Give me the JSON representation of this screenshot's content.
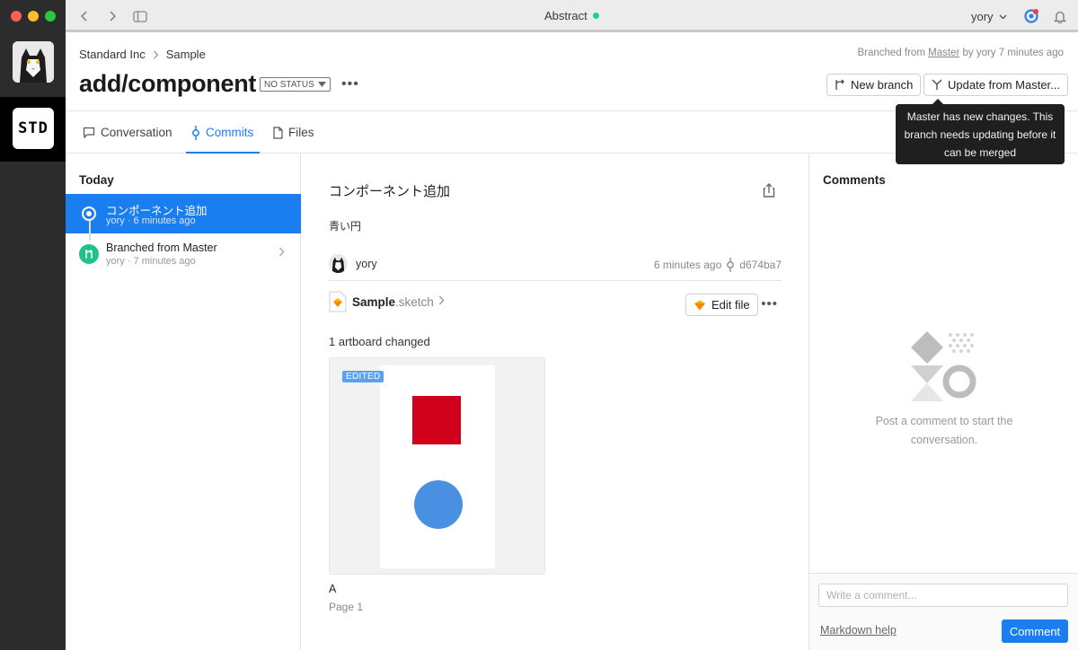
{
  "window": {
    "title": "Abstract",
    "user_name": "yory"
  },
  "org": {
    "logo_text": "STD"
  },
  "header": {
    "breadcrumb": [
      "Standard Inc",
      "Sample"
    ],
    "branched_meta": {
      "prefix": "Branched from",
      "branch_link": "Master",
      "suffix": "by yory 7 minutes ago"
    },
    "branch_title": "add/component",
    "status_label": "NO STATUS",
    "more_label": "•••",
    "new_branch_label": "New branch",
    "update_label": "Update from Master..."
  },
  "tooltip": {
    "text": "Master has new changes. This branch needs updating before it can be merged"
  },
  "tabs": [
    {
      "label": "Conversation",
      "icon": "chat-bubble-icon",
      "active": false
    },
    {
      "label": "Commits",
      "icon": "commit-icon",
      "active": true
    },
    {
      "label": "Files",
      "icon": "file-icon",
      "active": false
    }
  ],
  "commits": {
    "group_label": "Today",
    "items": [
      {
        "title": "コンポーネント追加",
        "subtitle": "yory · 6 minutes ago",
        "selected": true
      },
      {
        "title": "Branched from Master",
        "subtitle": "yory · 7 minutes ago",
        "selected": false
      }
    ]
  },
  "detail": {
    "title": "コンポーネント追加",
    "description": "青い円",
    "author": "yory",
    "time": "6 minutes ago",
    "sha": "d674ba7",
    "file": {
      "name": "Sample",
      "ext": ".sketch"
    },
    "edit_label": "Edit file",
    "more_label": "•••",
    "changed_label": "1 artboard changed",
    "artboard": {
      "badge": "EDITED",
      "name": "A",
      "page": "Page 1",
      "colors": {
        "square": "#d0021b",
        "circle": "#4a90e2"
      }
    }
  },
  "comments": {
    "title": "Comments",
    "empty_text": "Post a comment to start the conversation.",
    "input_placeholder": "Write a comment...",
    "markdown_help": "Markdown help",
    "comment_button": "Comment"
  },
  "colors": {
    "accent": "#1b7ef0",
    "merge_node": "#1fc28a",
    "rail": "#2c2c2c"
  }
}
